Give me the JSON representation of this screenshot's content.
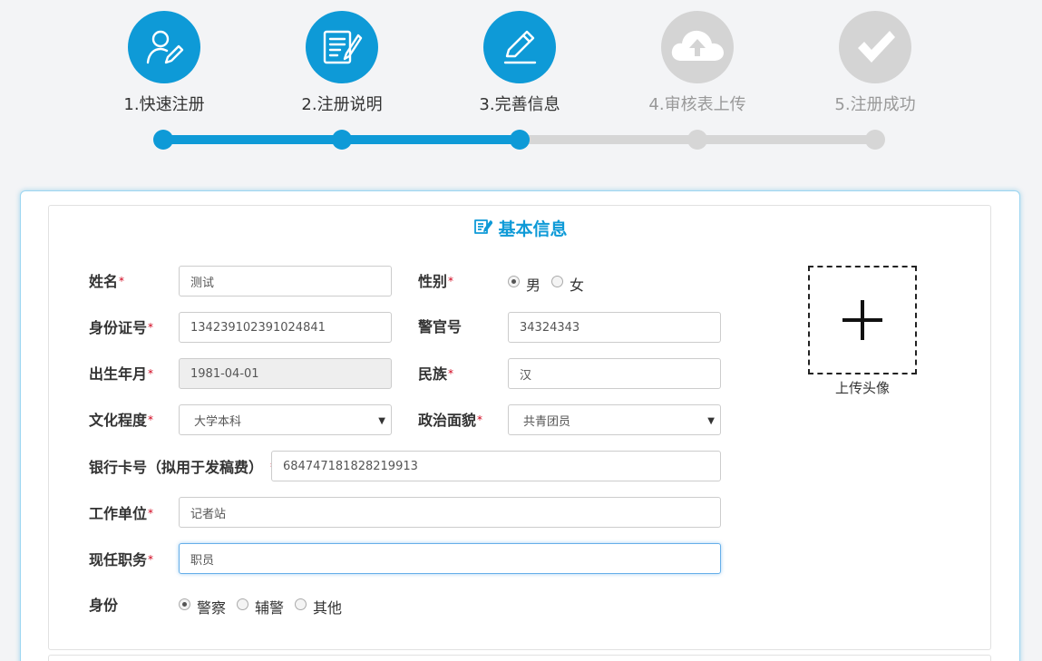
{
  "stepper": {
    "steps": [
      {
        "label": "1.快速注册",
        "state": "done",
        "icon": "user-edit-icon"
      },
      {
        "label": "2.注册说明",
        "state": "done",
        "icon": "document-edit-icon"
      },
      {
        "label": "3.完善信息",
        "state": "current",
        "icon": "pencil-icon"
      },
      {
        "label": "4.审核表上传",
        "state": "pending",
        "icon": "cloud-upload-icon"
      },
      {
        "label": "5.注册成功",
        "state": "pending",
        "icon": "checkmark-icon"
      }
    ]
  },
  "section": {
    "title": "基本信息",
    "icon": "edit-icon"
  },
  "form": {
    "name": {
      "label": "姓名",
      "value": "测试"
    },
    "gender": {
      "label": "性别",
      "options": [
        "男",
        "女"
      ],
      "selected": "男"
    },
    "id_number": {
      "label": "身份证号",
      "value": "134239102391024841"
    },
    "officer_no": {
      "label": "警官号",
      "value": "34324343"
    },
    "birth": {
      "label": "出生年月",
      "value": "1981-04-01"
    },
    "ethnicity": {
      "label": "民族",
      "value": "汉"
    },
    "education": {
      "label": "文化程度",
      "value": "大学本科"
    },
    "politics": {
      "label": "政治面貌",
      "value": "共青团员"
    },
    "bank_card": {
      "label": "银行卡号（拟用于发稿费）",
      "value": "684747181828219913"
    },
    "work_unit": {
      "label": "工作单位",
      "value": "记者站"
    },
    "position": {
      "label": "现任职务",
      "value": "职员"
    },
    "identity": {
      "label": "身份",
      "options": [
        "警察",
        "辅警",
        "其他"
      ],
      "selected": "警察"
    },
    "required_mark": "*"
  },
  "avatar": {
    "label": "上传头像",
    "icon": "plus-icon"
  },
  "colors": {
    "accent": "#0e9ad7",
    "inactive": "#d4d4d4",
    "required": "#d0021b"
  }
}
